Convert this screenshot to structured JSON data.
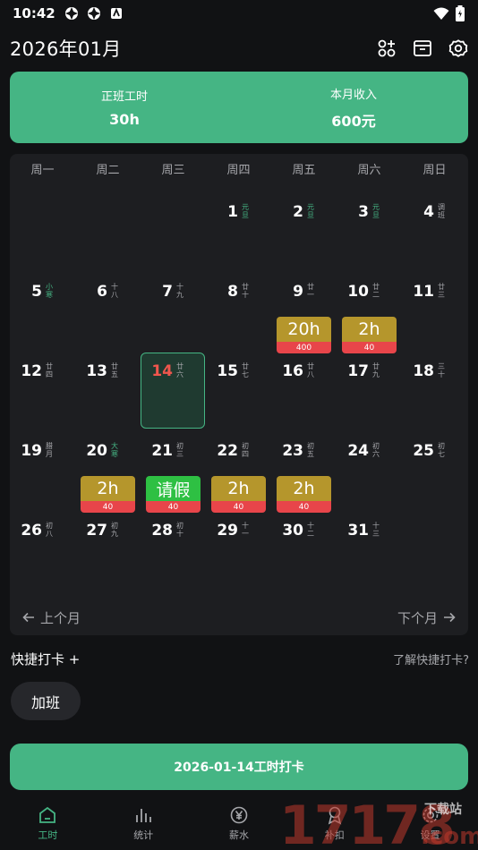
{
  "status": {
    "time": "10:42"
  },
  "header": {
    "month_title": "2026年01月"
  },
  "summary": {
    "hours_label": "正班工时",
    "hours_value": "30h",
    "income_label": "本月收入",
    "income_value": "600元"
  },
  "calendar": {
    "weekdays": [
      "周一",
      "周二",
      "周三",
      "周四",
      "周五",
      "周六",
      "周日"
    ],
    "days": [
      {
        "n": "1",
        "col": 3,
        "row": 0,
        "sub": "元旦",
        "green": true
      },
      {
        "n": "2",
        "col": 4,
        "row": 0,
        "sub": "元旦",
        "green": true
      },
      {
        "n": "3",
        "col": 5,
        "row": 0,
        "sub": "元旦",
        "green": true
      },
      {
        "n": "4",
        "col": 6,
        "row": 0,
        "sub": "调班"
      },
      {
        "n": "5",
        "col": 0,
        "row": 1,
        "sub": "小寒",
        "green": true
      },
      {
        "n": "6",
        "col": 1,
        "row": 1,
        "sub": "十八"
      },
      {
        "n": "7",
        "col": 2,
        "row": 1,
        "sub": "十九"
      },
      {
        "n": "8",
        "col": 3,
        "row": 1,
        "sub": "廿十"
      },
      {
        "n": "9",
        "col": 4,
        "row": 1,
        "sub": "廿一",
        "badge": {
          "top": "20h",
          "bot": "400",
          "color": "gold"
        }
      },
      {
        "n": "10",
        "col": 5,
        "row": 1,
        "sub": "廿二",
        "badge": {
          "top": "2h",
          "bot": "40",
          "color": "gold"
        }
      },
      {
        "n": "11",
        "col": 6,
        "row": 1,
        "sub": "廿三"
      },
      {
        "n": "12",
        "col": 0,
        "row": 2,
        "sub": "廿四"
      },
      {
        "n": "13",
        "col": 1,
        "row": 2,
        "sub": "廿五"
      },
      {
        "n": "14",
        "col": 2,
        "row": 2,
        "sub": "廿六",
        "today": true
      },
      {
        "n": "15",
        "col": 3,
        "row": 2,
        "sub": "廿七"
      },
      {
        "n": "16",
        "col": 4,
        "row": 2,
        "sub": "廿八"
      },
      {
        "n": "17",
        "col": 5,
        "row": 2,
        "sub": "廿九"
      },
      {
        "n": "18",
        "col": 6,
        "row": 2,
        "sub": "三十"
      },
      {
        "n": "19",
        "col": 0,
        "row": 3,
        "sub": "腊月"
      },
      {
        "n": "20",
        "col": 1,
        "row": 3,
        "sub": "大寒",
        "green": true,
        "badge": {
          "top": "2h",
          "bot": "40",
          "color": "gold"
        }
      },
      {
        "n": "21",
        "col": 2,
        "row": 3,
        "sub": "初三",
        "badge": {
          "top": "请假",
          "bot": "40",
          "color": "green"
        }
      },
      {
        "n": "22",
        "col": 3,
        "row": 3,
        "sub": "初四",
        "badge": {
          "top": "2h",
          "bot": "40",
          "color": "gold"
        }
      },
      {
        "n": "23",
        "col": 4,
        "row": 3,
        "sub": "初五",
        "badge": {
          "top": "2h",
          "bot": "40",
          "color": "gold"
        }
      },
      {
        "n": "24",
        "col": 5,
        "row": 3,
        "sub": "初六"
      },
      {
        "n": "25",
        "col": 6,
        "row": 3,
        "sub": "初七"
      },
      {
        "n": "26",
        "col": 0,
        "row": 4,
        "sub": "初八"
      },
      {
        "n": "27",
        "col": 1,
        "row": 4,
        "sub": "初九"
      },
      {
        "n": "28",
        "col": 2,
        "row": 4,
        "sub": "初十"
      },
      {
        "n": "29",
        "col": 3,
        "row": 4,
        "sub": "十一"
      },
      {
        "n": "30",
        "col": 4,
        "row": 4,
        "sub": "十二"
      },
      {
        "n": "31",
        "col": 5,
        "row": 4,
        "sub": "十三"
      }
    ],
    "prev_label": "上个月",
    "next_label": "下个月"
  },
  "quick": {
    "title": "快捷打卡 +",
    "learn": "了解快捷打卡?",
    "chip": "加班"
  },
  "clockin": {
    "label": "2026-01-14工时打卡"
  },
  "tabs": [
    "工时",
    "统计",
    "薪水",
    "补扣",
    "设置"
  ],
  "watermark": {
    "text": "17178",
    "sub": "下载站",
    "com": ".com"
  },
  "colors": {
    "accent": "#45b584",
    "gold": "#b5962c",
    "red": "#e8454a",
    "leave": "#2ec043"
  },
  "icons": [
    "settings-gear-icon",
    "grid-add-icon",
    "archive-icon",
    "home-icon",
    "bar-chart-icon",
    "yen-icon",
    "badge-icon"
  ]
}
